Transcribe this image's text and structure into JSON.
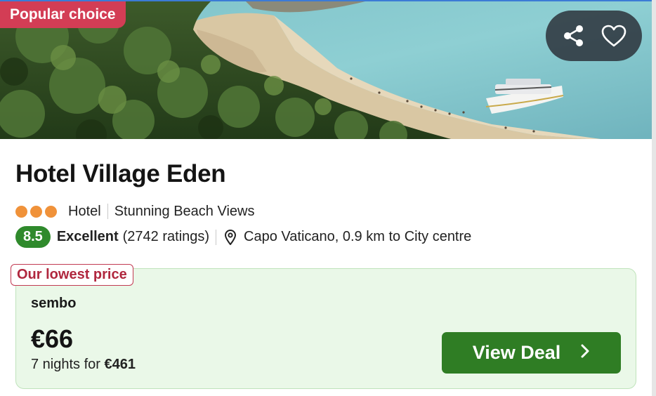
{
  "badges": {
    "popular": "Popular choice",
    "lowest": "Our lowest price"
  },
  "hotel": {
    "name": "Hotel Village Eden",
    "stars": 3,
    "type": "Hotel",
    "feature": "Stunning Beach Views",
    "score": "8.5",
    "rating_label": "Excellent",
    "ratings_count": "(2742 ratings)",
    "location": "Capo Vaticano, 0.9 km to City centre"
  },
  "deal": {
    "provider": "sembo",
    "price": "€66",
    "nights_prefix": "7 nights for ",
    "total": "€461",
    "cta_label": "View Deal"
  },
  "icons": {
    "share": "share-icon",
    "favorite": "heart-icon",
    "location": "map-pin-icon",
    "cta": "chevron-right-icon"
  },
  "colors": {
    "popular_badge": "#d33d55",
    "star_dot": "#f0923a",
    "score_badge": "#2f8a2c",
    "deal_bg": "#eaf8e8",
    "cta_bg": "#2f7d24",
    "lowest_text": "#b0273e"
  }
}
